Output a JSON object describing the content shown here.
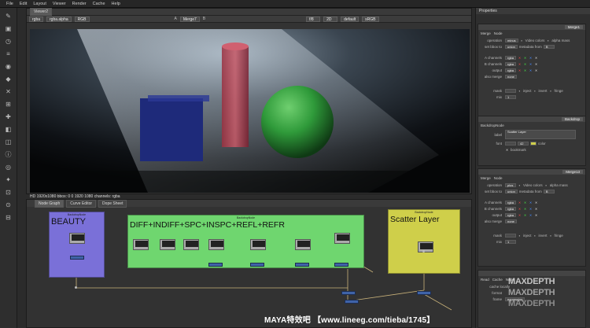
{
  "menu": [
    "File",
    "Edit",
    "Layout",
    "Viewer",
    "Render",
    "Cache",
    "Help"
  ],
  "viewer": {
    "tab": "Viewer2",
    "channels": "rgba",
    "alpha": "rgba.alpha",
    "colorspace": "RGB",
    "input_a": "A",
    "input_a_node": "Merge7",
    "input_b": "B",
    "gain": "f/8",
    "mode": "2D",
    "lut": "default",
    "output": "sRGB",
    "status": "HD 1920x1080  bbox: 0 0 1920 1080  channels: rgba"
  },
  "nodegraph": {
    "tabs": [
      "Node Graph",
      "Curve Editor",
      "Dope Sheet"
    ],
    "backdrops": [
      {
        "label": "BEAUTY",
        "title": "BackdropNode",
        "color": "#7a70d8"
      },
      {
        "label": "DIFF+INDIFF+SPC+INSPC+REFL+REFR",
        "title": "BackdropNode",
        "color": "#6fd66f"
      },
      {
        "label": "Scatter Layer",
        "title": "BackdropNode",
        "color": "#cfcf4a"
      }
    ]
  },
  "properties": {
    "header": "Properties",
    "block1": {
      "name": "Merge1",
      "tabs": [
        "Merge",
        "Node"
      ],
      "operation": "minus",
      "bbox": "union",
      "mix": "1",
      "video_colors": "Video colors",
      "alpha_masks": "alpha mass",
      "metadata_from": "B",
      "also_merge": "none",
      "mask_label": "mask",
      "inject": "inject",
      "invert": "invert",
      "fringe": "fringe"
    },
    "block2": {
      "name": "Backdrop",
      "title": "BackdropNode",
      "label_key": "label",
      "label_val": "Scatter Layer",
      "font_key": "font",
      "font_val": "42",
      "bookmark": "bookmark",
      "color": "color"
    },
    "block3": {
      "name": "Merge13",
      "tabs": [
        "Merge",
        "Node"
      ],
      "operation": "plus",
      "bbox": "union",
      "mix": "1",
      "video_colors": "Video colors",
      "alpha_masks": "alpha mass",
      "metadata_from": "B",
      "also_merge": "none",
      "mask_label": "mask",
      "inject": "inject",
      "invert": "invert",
      "fringe": "fringe"
    },
    "block4": {
      "name": "Read",
      "tabs": [
        "Read",
        "Cache",
        "Node"
      ],
      "cache_local": "cache locally",
      "format": "format",
      "frame": "frame",
      "expression": "expression"
    },
    "labels": {
      "operation": "operation",
      "bbox": "set bbox to",
      "a": "A channels",
      "b": "B channels",
      "out": "output",
      "also": "also merge",
      "mix": "mix",
      "meta": "metadata from"
    }
  },
  "watermark": {
    "brand": "MAXDEPTH",
    "caption": "MAYA特效吧  【www.lineeg.com/tieba/1745】"
  },
  "accent": "#3f63a8"
}
